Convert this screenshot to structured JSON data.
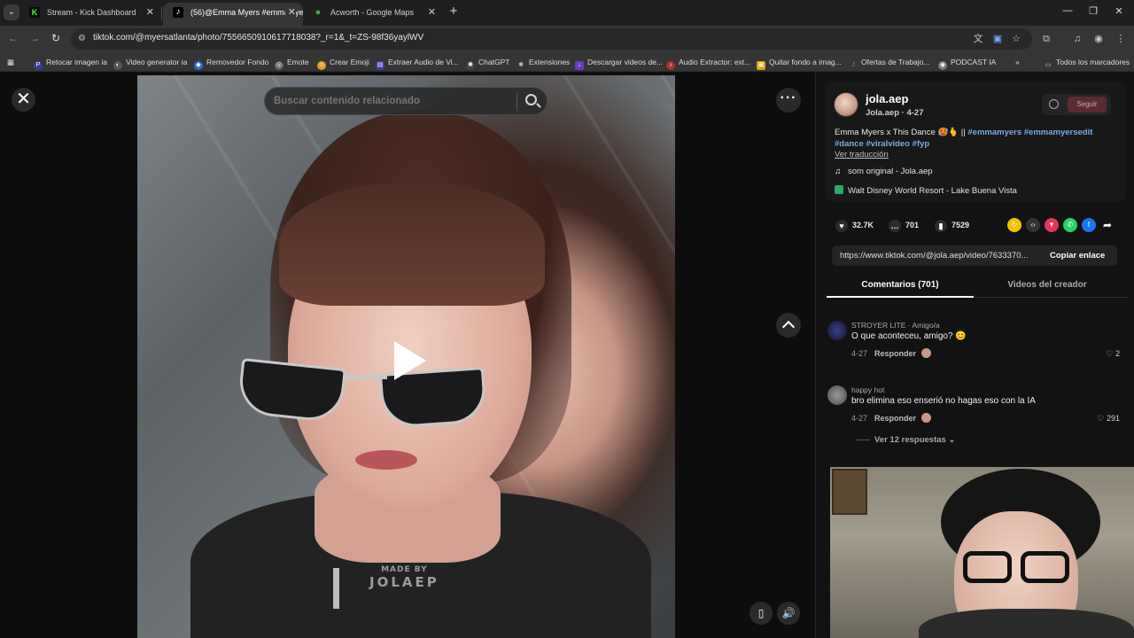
{
  "browser": {
    "tabs": [
      {
        "title": "Stream - Kick Dashboard",
        "favicon": "K",
        "color": "#53fc18"
      },
      {
        "title": "(56)@Emma Myers #emmamye",
        "favicon": "♪",
        "color": "#ffffff"
      },
      {
        "title": "Acworth - Google Maps",
        "favicon": "●",
        "color": "#34a853"
      }
    ],
    "url": "tiktok.com/@myersatlanta/photo/7556650910617718038?_r=1&_t=ZS-98f36yaylWV",
    "bookmarks": [
      "Retocar imagen ia",
      "Video generator ia",
      "Removedor Fondo",
      "Emote",
      "Crear Emoji",
      "Extraer Audio de Vi...",
      "ChatGPT",
      "Extensiones",
      "Descargar videos de...",
      "Audio Extractor: ext...",
      "Quitar fondo a imag...",
      "Ofertas de Trabajo...",
      "PODCAST IA",
      "Todos los marcadores"
    ]
  },
  "viewer": {
    "search_placeholder": "Buscar contenido relacionado",
    "watermark_top": "MADE BY",
    "watermark_bottom": "JOLAEP"
  },
  "post": {
    "username": "jola.aep",
    "subline": "Jola.aep · 4-27",
    "follow_label": "Seguir",
    "desc_text": "Emma Myers x This Dance 🥵🫰 || ",
    "hashtags_line1": "#emmamyers #emmamyersedit",
    "hashtags_line2": "#dance #viralvideo #fyp",
    "translate": "Ver traducción",
    "music": "som original - Jola.aep",
    "location": "Walt Disney World Resort - Lake Buena Vista",
    "likes": "32.7K",
    "comments": "701",
    "saves": "7529",
    "share_link": "https://www.tiktok.com/@jola.aep/video/7633370...",
    "copy_label": "Copiar enlace",
    "tab_comments": "Comentarios (701)",
    "tab_creator": "Videos del creador"
  },
  "comments": [
    {
      "name": "STROYER LITE · Amigo/a",
      "text": "O que aconteceu, amigo? 😊",
      "date": "4-27",
      "reply": "Responder",
      "likes": "2"
    },
    {
      "name": "happy hot",
      "text": "bro elimina eso enserió no hagas eso con la IA",
      "date": "4-27",
      "reply": "Responder",
      "likes": "291"
    }
  ],
  "view_replies": "Ver 12 respuestas ⌄"
}
